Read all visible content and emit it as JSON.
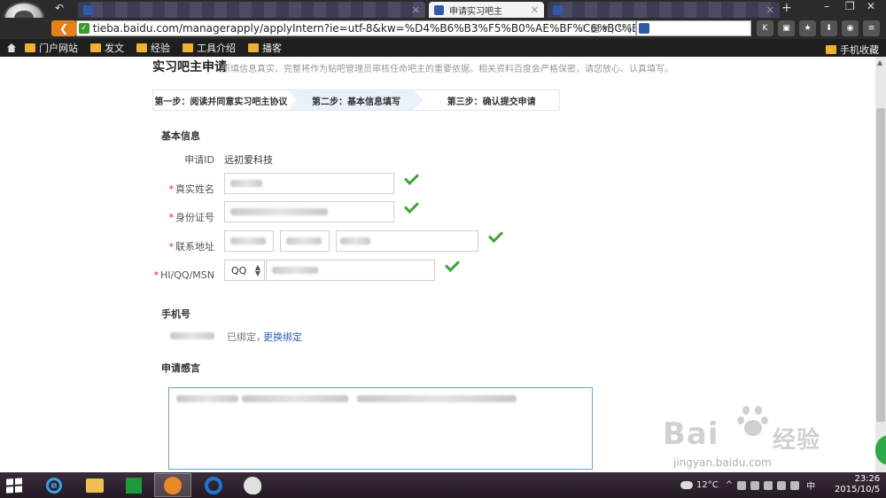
{
  "browser": {
    "active_tab_title": "申请实习吧主",
    "url": "tieba.baidu.com/managerapply/applyIntern?ie=utf-8&kw=%D4%B6%B3%F5%B0%AE%BF%C6%BC%BC",
    "new_tab_symbol": "+",
    "window_controls": [
      "–",
      "❐",
      "✕"
    ]
  },
  "bookmarks": {
    "items": [
      "门户网站",
      "发文",
      "经验",
      "工具介绍",
      "播客"
    ],
    "mobile_bookmarks": "手机收藏"
  },
  "page": {
    "title": "实习吧主申请",
    "subtitle": "所填信息真实、完整将作为贴吧管理员审核任命吧主的重要依据。相关资料百度会严格保密，请您放心、认真填写。",
    "steps": [
      "第一步：阅读并同意实习吧主协议",
      "第二步：基本信息填写",
      "第三步：确认提交申请"
    ],
    "basic_info": {
      "section_title": "基本信息",
      "apply_id_label": "申请ID",
      "apply_id_value": "远初爱科技",
      "real_name_label": "真实姓名",
      "id_number_label": "身份证号",
      "address_label": "联系地址",
      "im_label": "HI/QQ/MSN",
      "im_type": "QQ"
    },
    "phone": {
      "section_title": "手机号",
      "bound_text": "已绑定，",
      "change_link": "更换绑定"
    },
    "statement": {
      "section_title": "申请感言"
    }
  },
  "watermark": {
    "brand_left": "Bai",
    "brand_right": "经验",
    "url": "jingyan.baidu.com"
  },
  "taskbar": {
    "temperature": "12°C",
    "ime": "中",
    "time": "23:26",
    "date": "2015/10/5"
  }
}
